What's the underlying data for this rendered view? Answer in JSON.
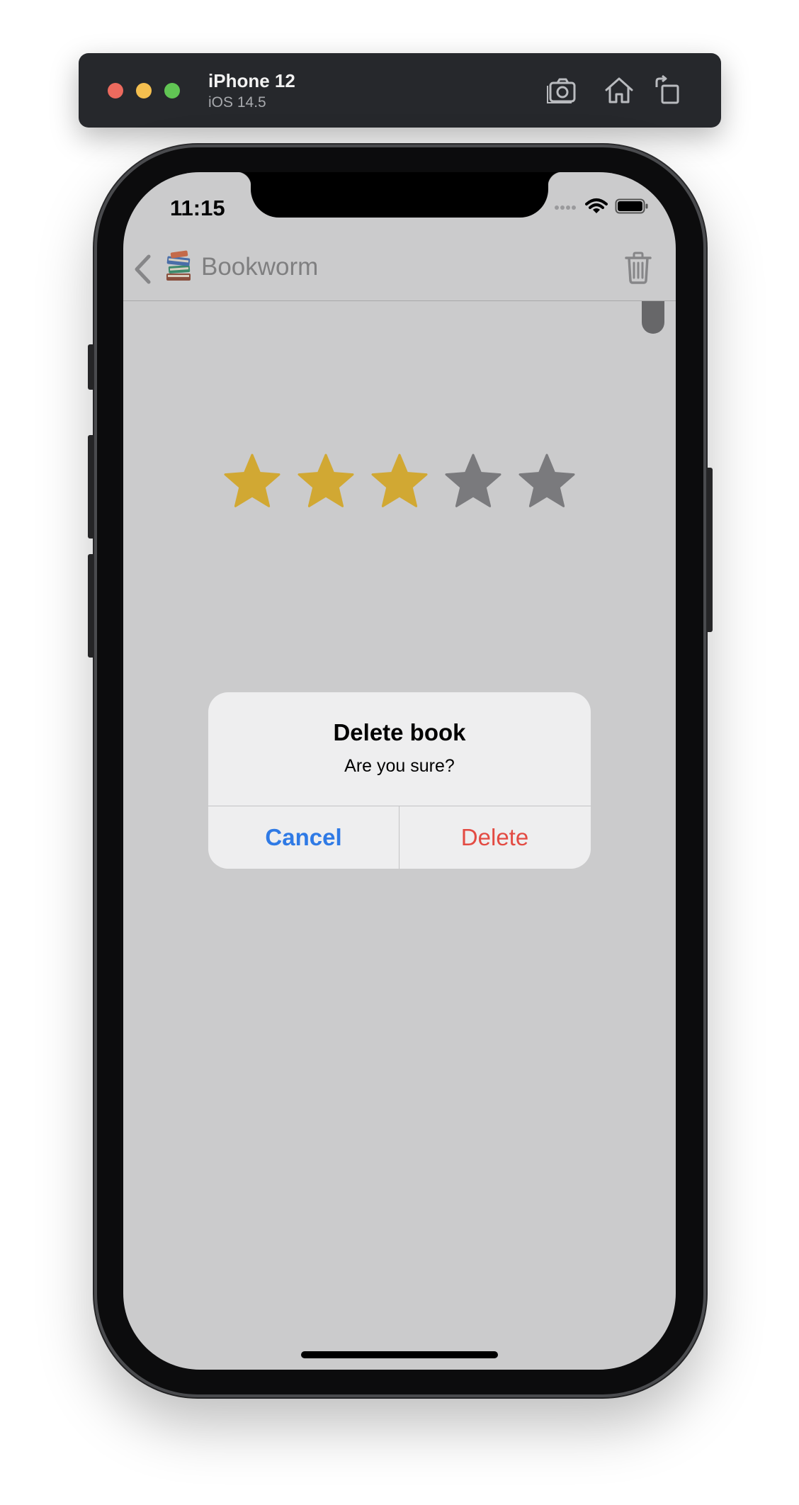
{
  "simulator": {
    "device_name": "iPhone 12",
    "os_version": "iOS 14.5",
    "icons": [
      "screenshot-icon",
      "home-icon",
      "rotate-icon"
    ]
  },
  "status_bar": {
    "time": "11:15",
    "icons": [
      "signal-icon",
      "wifi-icon",
      "battery-icon"
    ]
  },
  "navbar": {
    "title_emoji": "📚",
    "title": "Bookworm",
    "icons": [
      "back-chevron-icon",
      "trash-icon"
    ]
  },
  "rating": {
    "value": 3,
    "max": 5,
    "filled_color": "#d1a833",
    "empty_color": "#7a7a7d"
  },
  "alert": {
    "title": "Delete book",
    "message": "Are you sure?",
    "cancel_label": "Cancel",
    "delete_label": "Delete"
  },
  "colors": {
    "cancel": "#2f7ae5",
    "destructive": "#e34b43"
  }
}
